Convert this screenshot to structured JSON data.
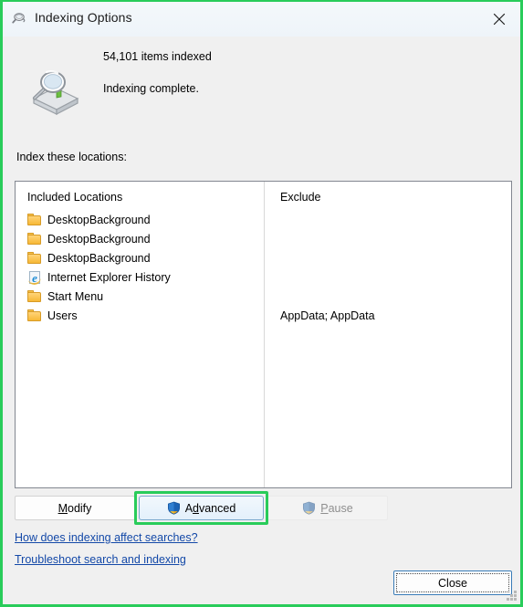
{
  "window": {
    "title": "Indexing Options",
    "title_icon": "indexing-magnifier-icon",
    "close_icon": "close-icon"
  },
  "status": {
    "icon": "indexing-drive-magnifier-icon",
    "items_indexed": "54,101 items indexed",
    "state": "Indexing complete."
  },
  "section": {
    "label": "Index these locations:"
  },
  "list": {
    "columns": {
      "included": "Included Locations",
      "exclude": "Exclude"
    },
    "rows": [
      {
        "icon": "folder-icon",
        "name": "DesktopBackground",
        "exclude": ""
      },
      {
        "icon": "folder-icon",
        "name": "DesktopBackground",
        "exclude": ""
      },
      {
        "icon": "folder-icon",
        "name": "DesktopBackground",
        "exclude": ""
      },
      {
        "icon": "internet-explorer-icon",
        "name": "Internet Explorer History",
        "exclude": ""
      },
      {
        "icon": "folder-icon",
        "name": "Start Menu",
        "exclude": ""
      },
      {
        "icon": "folder-icon",
        "name": "Users",
        "exclude": "AppData; AppData"
      }
    ]
  },
  "buttons": {
    "modify": {
      "label": "Modify",
      "accel": "M",
      "enabled": true,
      "shield": false
    },
    "advanced": {
      "label": "Advanced",
      "accel": "v",
      "enabled": true,
      "shield": true,
      "highlighted": true
    },
    "pause": {
      "label": "Pause",
      "accel": "P",
      "enabled": false,
      "shield": true
    },
    "close": {
      "label": "Close",
      "default": true
    }
  },
  "links": {
    "how": "How does indexing affect searches?",
    "troubleshoot": "Troubleshoot search and indexing"
  },
  "colors": {
    "highlight": "#29cc5a",
    "link": "#1449a8",
    "titlebar": "#f2f7fb",
    "dialog_background": "#f0f0f0",
    "accent_button_border": "#7aa7cc"
  }
}
